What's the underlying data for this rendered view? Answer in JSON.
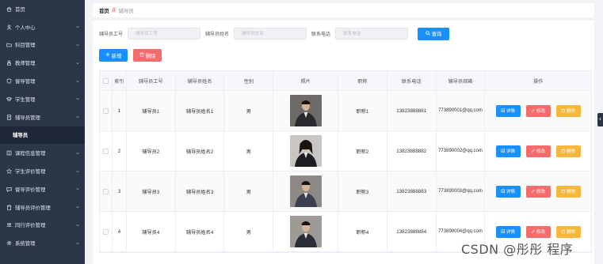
{
  "colors": {
    "sidebar_bg": "#2b3648",
    "primary": "#1890ff",
    "danger": "#f56c6c",
    "warning": "#f6b73c"
  },
  "sidebar": {
    "items": [
      {
        "label": "首页",
        "icon": "home-icon",
        "chevron": false
      },
      {
        "label": "个人中心",
        "icon": "user-icon",
        "chevron": true
      },
      {
        "label": "科目管理",
        "icon": "folder-icon",
        "chevron": true
      },
      {
        "label": "教师管理",
        "icon": "teacher-icon",
        "chevron": true
      },
      {
        "label": "督导管理",
        "icon": "shield-icon",
        "chevron": true
      },
      {
        "label": "学生管理",
        "icon": "student-icon",
        "chevron": true
      },
      {
        "label": "辅导员管理",
        "icon": "document-icon",
        "chevron": true
      },
      {
        "label": "辅导员",
        "icon": "",
        "chevron": false,
        "sub": true
      },
      {
        "label": "课程信息管理",
        "icon": "book-icon",
        "chevron": true
      },
      {
        "label": "学生评价管理",
        "icon": "star-icon",
        "chevron": true
      },
      {
        "label": "督导评价管理",
        "icon": "chat-icon",
        "chevron": true
      },
      {
        "label": "辅导员评价管理",
        "icon": "clipboard-icon",
        "chevron": true
      },
      {
        "label": "同行评价管理",
        "icon": "people-icon",
        "chevron": true
      },
      {
        "label": "系统管理",
        "icon": "gear-icon",
        "chevron": true
      }
    ]
  },
  "breadcrumb": {
    "home": "首页",
    "separator": "//",
    "current": "辅导员"
  },
  "search": {
    "fields": [
      {
        "label": "辅导员工号",
        "placeholder": "辅导员工号"
      },
      {
        "label": "辅导员姓名",
        "placeholder": "辅导员姓名"
      },
      {
        "label": "联系电话",
        "placeholder": "联系电话"
      }
    ],
    "button": "查询"
  },
  "actions": {
    "add": "新增",
    "delete": "删除"
  },
  "table": {
    "headers": [
      "",
      "索引",
      "辅导员工号",
      "辅导员姓名",
      "性别",
      "照片",
      "职称",
      "联系电话",
      "辅导员邮箱",
      "操作"
    ],
    "ops": {
      "detail": "详情",
      "edit": "修改",
      "remove": "删除"
    },
    "rows": [
      {
        "idx": "1",
        "no": "辅导员1",
        "name": "辅导员姓名1",
        "sex": "男",
        "title": "职称1",
        "phone": "13823888881",
        "mail": "773890001@qq.com"
      },
      {
        "idx": "2",
        "no": "辅导员2",
        "name": "辅导员姓名2",
        "sex": "男",
        "title": "职称2",
        "phone": "13823888882",
        "mail": "773890002@qq.com"
      },
      {
        "idx": "3",
        "no": "辅导员3",
        "name": "辅导员姓名3",
        "sex": "男",
        "title": "职称3",
        "phone": "13823888883",
        "mail": "773890003@qq.com"
      },
      {
        "idx": "4",
        "no": "辅导员4",
        "name": "辅导员姓名4",
        "sex": "男",
        "title": "职称4",
        "phone": "13823888884",
        "mail": "773890004@qq.com"
      }
    ]
  },
  "watermark": "CSDN @彤彤 程序"
}
